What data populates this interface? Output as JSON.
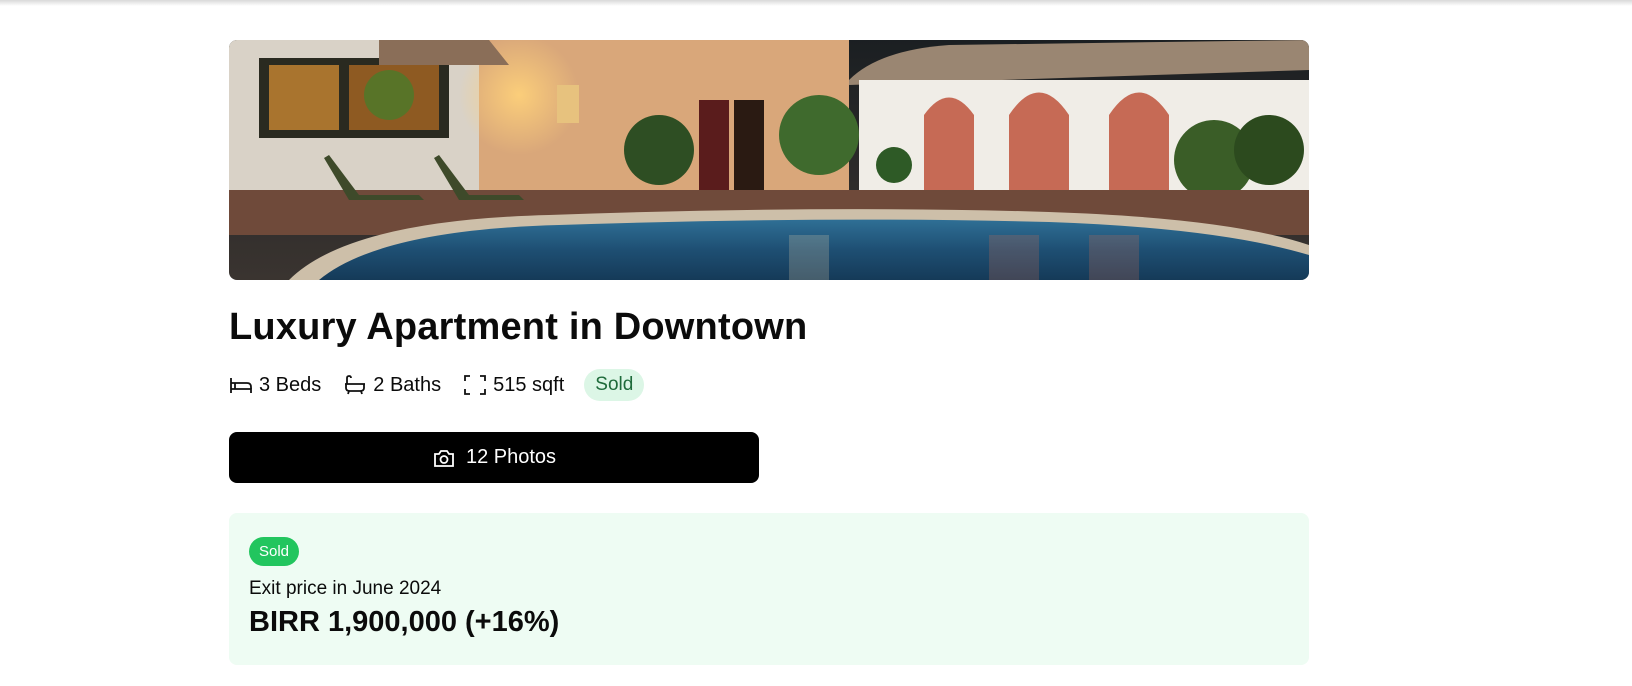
{
  "listing": {
    "title": "Luxury Apartment in Downtown",
    "hero_image": "courtyard-pool-night-photo",
    "features": {
      "beds": "3 Beds",
      "baths": "2 Baths",
      "area": "515 sqft"
    },
    "status": "Sold",
    "photos_button": "12 Photos"
  },
  "sold_card": {
    "badge": "Sold",
    "exit_label": "Exit price in June 2024",
    "exit_price": "BIRR 1,900,000 (+16%)"
  },
  "icons": {
    "bed": "bed-icon",
    "bath": "bath-icon",
    "area": "area-icon",
    "camera": "camera-icon"
  },
  "colors": {
    "status_pill_bg": "#dcf6e6",
    "status_pill_text": "#1f6b3b",
    "sold_badge": "#22c55e",
    "sold_card_bg": "#eefcf3",
    "button_bg": "#000000"
  }
}
